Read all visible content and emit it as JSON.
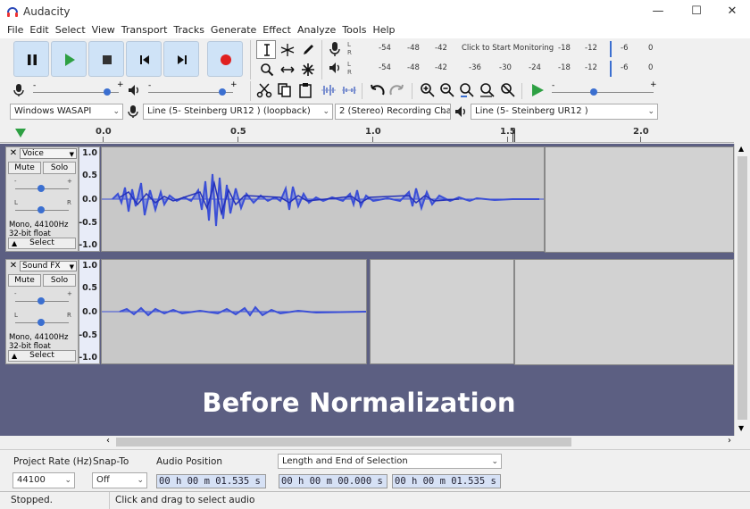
{
  "window": {
    "title": "Audacity",
    "minimize": "—",
    "maximize": "☐",
    "close": "✕"
  },
  "menu": [
    "File",
    "Edit",
    "Select",
    "View",
    "Transport",
    "Tracks",
    "Generate",
    "Effect",
    "Analyze",
    "Tools",
    "Help"
  ],
  "transport": {
    "buttons": [
      "pause-icon",
      "play-icon",
      "stop-icon",
      "skip-to-start-icon",
      "skip-to-end-icon",
      "record-icon"
    ],
    "accent": "#cfe3f7",
    "record_color": "#e02020",
    "play_color": "#2ea043"
  },
  "tools": [
    "selection-tool-icon",
    "envelope-tool-icon",
    "draw-tool-icon",
    "zoom-tool-icon",
    "time-shift-tool-icon",
    "multi-tool-icon"
  ],
  "meters": {
    "record_scale": [
      "-54",
      "-48",
      "-42",
      "Click to Start Monitoring",
      "-18",
      "-12",
      "-6",
      "0"
    ],
    "play_scale": [
      "-54",
      "-48",
      "-42",
      "-36",
      "-30",
      "-24",
      "-18",
      "-12",
      "-6",
      "0"
    ],
    "L": "L",
    "R": "R"
  },
  "mixer": {
    "minus": "-",
    "plus": "+"
  },
  "devices": {
    "host": "Windows WASAPI",
    "recording_device": "Line (5- Steinberg UR12 ) (loopback)",
    "channels": "2 (Stereo) Recording Chan",
    "playback_device": "Line (5- Steinberg UR12 )"
  },
  "timeline": {
    "labels": [
      "0.0",
      "0.5",
      "1.0",
      "1.5",
      "2.0"
    ]
  },
  "tracks": [
    {
      "name": "Voice",
      "mute": "Mute",
      "solo": "Solo",
      "gain_minus": "-",
      "gain_plus": "+",
      "pan_left": "L",
      "pan_right": "R",
      "info_line1": "Mono, 44100Hz",
      "info_line2": "32-bit float",
      "select": "Select",
      "collapse": "▲",
      "scale": [
        "1.0",
        "0.5",
        "0.0",
        "-0.5",
        "-1.0"
      ],
      "wave_color": "#3b4fd6"
    },
    {
      "name": "Sound FX",
      "mute": "Mute",
      "solo": "Solo",
      "gain_minus": "-",
      "gain_plus": "+",
      "pan_left": "L",
      "pan_right": "R",
      "info_line1": "Mono, 44100Hz",
      "info_line2": "32-bit float",
      "select": "Select",
      "collapse": "▲",
      "scale": [
        "1.0",
        "0.5",
        "0.0",
        "-0.5",
        "-1.0"
      ],
      "wave_color": "#3b4fd6"
    }
  ],
  "overlay": "Before Normalization",
  "selection_toolbar": {
    "project_rate_label": "Project Rate (Hz)",
    "project_rate": "44100",
    "snap_label": "Snap-To",
    "snap_value": "Off",
    "audio_position_label": "Audio Position",
    "audio_position": "00 h 00 m 01.535 s",
    "selection_mode": "Length and End of Selection",
    "selection_length": "00 h 00 m 00.000 s",
    "selection_end": "00 h 00 m 01.535 s"
  },
  "status": {
    "state": "Stopped.",
    "hint": "Click and drag to select audio"
  }
}
